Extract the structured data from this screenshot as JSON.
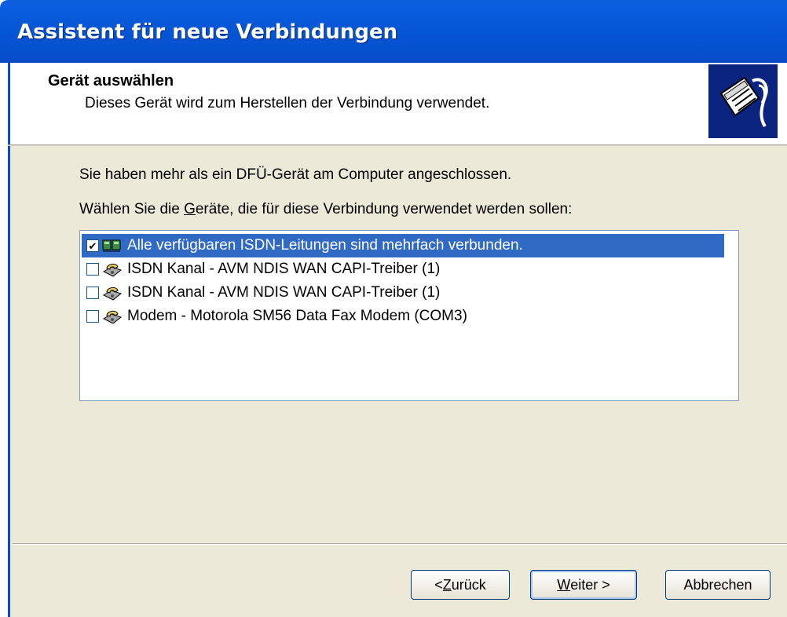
{
  "window": {
    "title": "Assistent für neue Verbindungen"
  },
  "header": {
    "title": "Gerät auswählen",
    "subtitle": "Dieses Gerät wird zum Herstellen der Verbindung verwendet.",
    "icon": "phone-connection-icon"
  },
  "body": {
    "intro": "Sie haben mehr als ein DFÜ-Gerät am Computer angeschlossen.",
    "choose_label_prefix": "Wählen Sie die ",
    "choose_label_accel": "G",
    "choose_label_suffix": "eräte, die für diese Verbindung verwendet werden sollen:"
  },
  "devices": [
    {
      "label": "Alle verfügbaren ISDN-Leitungen sind mehrfach verbunden.",
      "checked": true,
      "selected": true,
      "icon": "isdn-multilink-icon"
    },
    {
      "label": "ISDN  Kanal  - AVM NDIS WAN CAPI-Treiber (1)",
      "checked": false,
      "selected": false,
      "icon": "modem-phone-icon"
    },
    {
      "label": "ISDN  Kanal  - AVM NDIS WAN CAPI-Treiber (1)",
      "checked": false,
      "selected": false,
      "icon": "modem-phone-icon"
    },
    {
      "label": "Modem - Motorola SM56 Data Fax Modem (COM3)",
      "checked": false,
      "selected": false,
      "icon": "modem-phone-icon"
    }
  ],
  "buttons": {
    "back_prefix": "< ",
    "back_accel": "Z",
    "back_suffix": "urück",
    "next_accel": "W",
    "next_suffix": "eiter >",
    "cancel": "Abbrechen"
  },
  "colors": {
    "titlebar": "#0757d6",
    "selection": "#316ac5",
    "dialog_bg": "#ece9d8"
  }
}
